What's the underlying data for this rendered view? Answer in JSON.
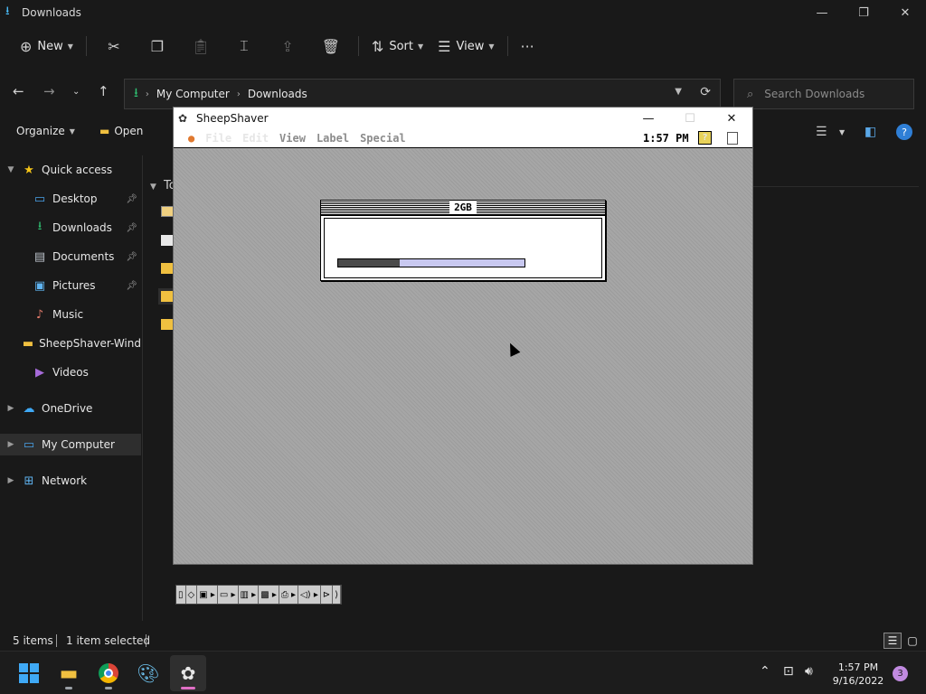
{
  "explorer": {
    "window_title": "Downloads",
    "window_controls": {
      "minimize": "—",
      "maximize": "❐",
      "close": "✕"
    },
    "toolbar": {
      "new_label": "New",
      "sort_label": "Sort",
      "view_label": "View",
      "more_glyph": "···"
    },
    "address": {
      "crumbs": [
        "My Computer",
        "Downloads"
      ]
    },
    "search": {
      "placeholder": "Search Downloads"
    },
    "command_row": {
      "organize_label": "Organize",
      "open_label": "Open"
    },
    "sidebar": {
      "items": [
        {
          "label": "Quick access",
          "icon": "star-icon"
        },
        {
          "label": "Desktop",
          "icon": "desktop-icon",
          "pinned": true
        },
        {
          "label": "Downloads",
          "icon": "download-icon",
          "pinned": true
        },
        {
          "label": "Documents",
          "icon": "document-icon",
          "pinned": true
        },
        {
          "label": "Pictures",
          "icon": "pictures-icon",
          "pinned": true
        },
        {
          "label": "Music",
          "icon": "music-icon"
        },
        {
          "label": "SheepShaver-Wind",
          "icon": "folder-icon"
        },
        {
          "label": "Videos",
          "icon": "videos-icon"
        },
        {
          "label": "OneDrive",
          "icon": "cloud-icon"
        },
        {
          "label": "My Computer",
          "icon": "computer-icon",
          "selected": true
        },
        {
          "label": "Network",
          "icon": "network-icon"
        }
      ]
    },
    "content": {
      "header_partial": "To"
    },
    "status": {
      "items_count": "5 items",
      "selection": "1 item selected"
    }
  },
  "sheepshaver": {
    "window_title": "SheepShaver",
    "menu": {
      "items": [
        {
          "label": "File",
          "enabled": true
        },
        {
          "label": "Edit",
          "enabled": true
        },
        {
          "label": "View",
          "enabled": false
        },
        {
          "label": "Label",
          "enabled": false
        },
        {
          "label": "Special",
          "enabled": false
        }
      ],
      "clock": "1:57 PM"
    },
    "progress_dialog": {
      "title": "2GB",
      "progress": 0.33
    }
  },
  "taskbar": {
    "clock_time": "1:57 PM",
    "clock_date": "9/16/2022",
    "notification_count": "3"
  },
  "colors": {
    "accent_download": "#2fbf71",
    "selection_bg": "#2e2e2e",
    "progress_track": "#c8c8f0",
    "progress_fill": "#4a4a4a",
    "active_app_indicator": "#e06fc6"
  }
}
